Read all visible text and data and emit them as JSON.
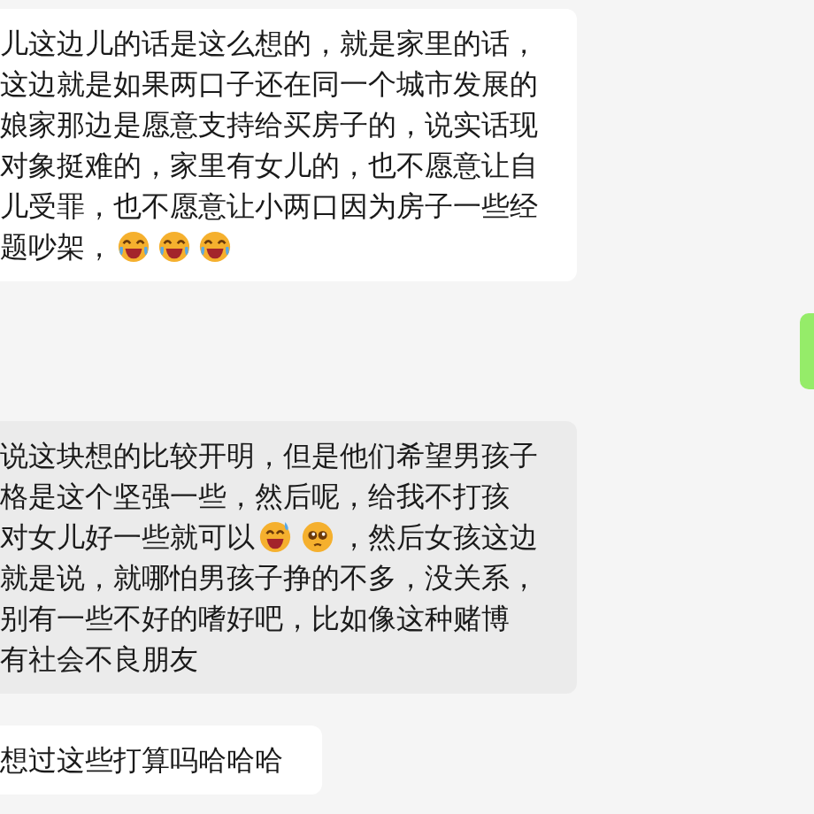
{
  "messages": [
    {
      "kind": "received",
      "color": "#ffffff",
      "lines": [
        [
          {
            "kind": "text",
            "text": "儿这边儿的话是这么想的，就是家里的话，"
          }
        ],
        [
          {
            "kind": "text",
            "text": "这边就是如果两口子还在同一个城市发展的"
          }
        ],
        [
          {
            "kind": "text",
            "text": "娘家那边是愿意支持给买房子的，说实话现"
          }
        ],
        [
          {
            "kind": "text",
            "text": "对象挺难的，家里有女儿的，也不愿意让自"
          }
        ],
        [
          {
            "kind": "text",
            "text": "儿受罪，也不愿意让小两口因为房子一些经"
          }
        ],
        [
          {
            "kind": "text",
            "text": "题吵架，"
          },
          {
            "kind": "laugh"
          },
          {
            "kind": "laugh"
          },
          {
            "kind": "laugh"
          }
        ]
      ]
    },
    {
      "kind": "sent",
      "color": "#95ec69"
    },
    {
      "kind": "received",
      "color": "#ebebeb",
      "lines": [
        [
          {
            "kind": "text",
            "text": "说这块想的比较开明，但是他们希望男孩子"
          }
        ],
        [
          {
            "kind": "text",
            "text": "格是这个坚强一些，然后呢，给我不打孩"
          }
        ],
        [
          {
            "kind": "text",
            "text": "对女儿好一些就可以"
          },
          {
            "kind": "sweat"
          },
          {
            "kind": "plead"
          },
          {
            "kind": "text",
            "text": "，然后女孩这边"
          }
        ],
        [
          {
            "kind": "text",
            "text": "就是说，就哪怕男孩子挣的不多，没关系，"
          }
        ],
        [
          {
            "kind": "text",
            "text": "别有一些不好的嗜好吧，比如像这种赌博"
          }
        ],
        [
          {
            "kind": "text",
            "text": "有社会不良朋友"
          }
        ]
      ]
    },
    {
      "kind": "received",
      "color": "#ffffff",
      "lines": [
        [
          {
            "kind": "text",
            "text": "想过这些打算吗哈哈哈"
          }
        ]
      ]
    }
  ]
}
